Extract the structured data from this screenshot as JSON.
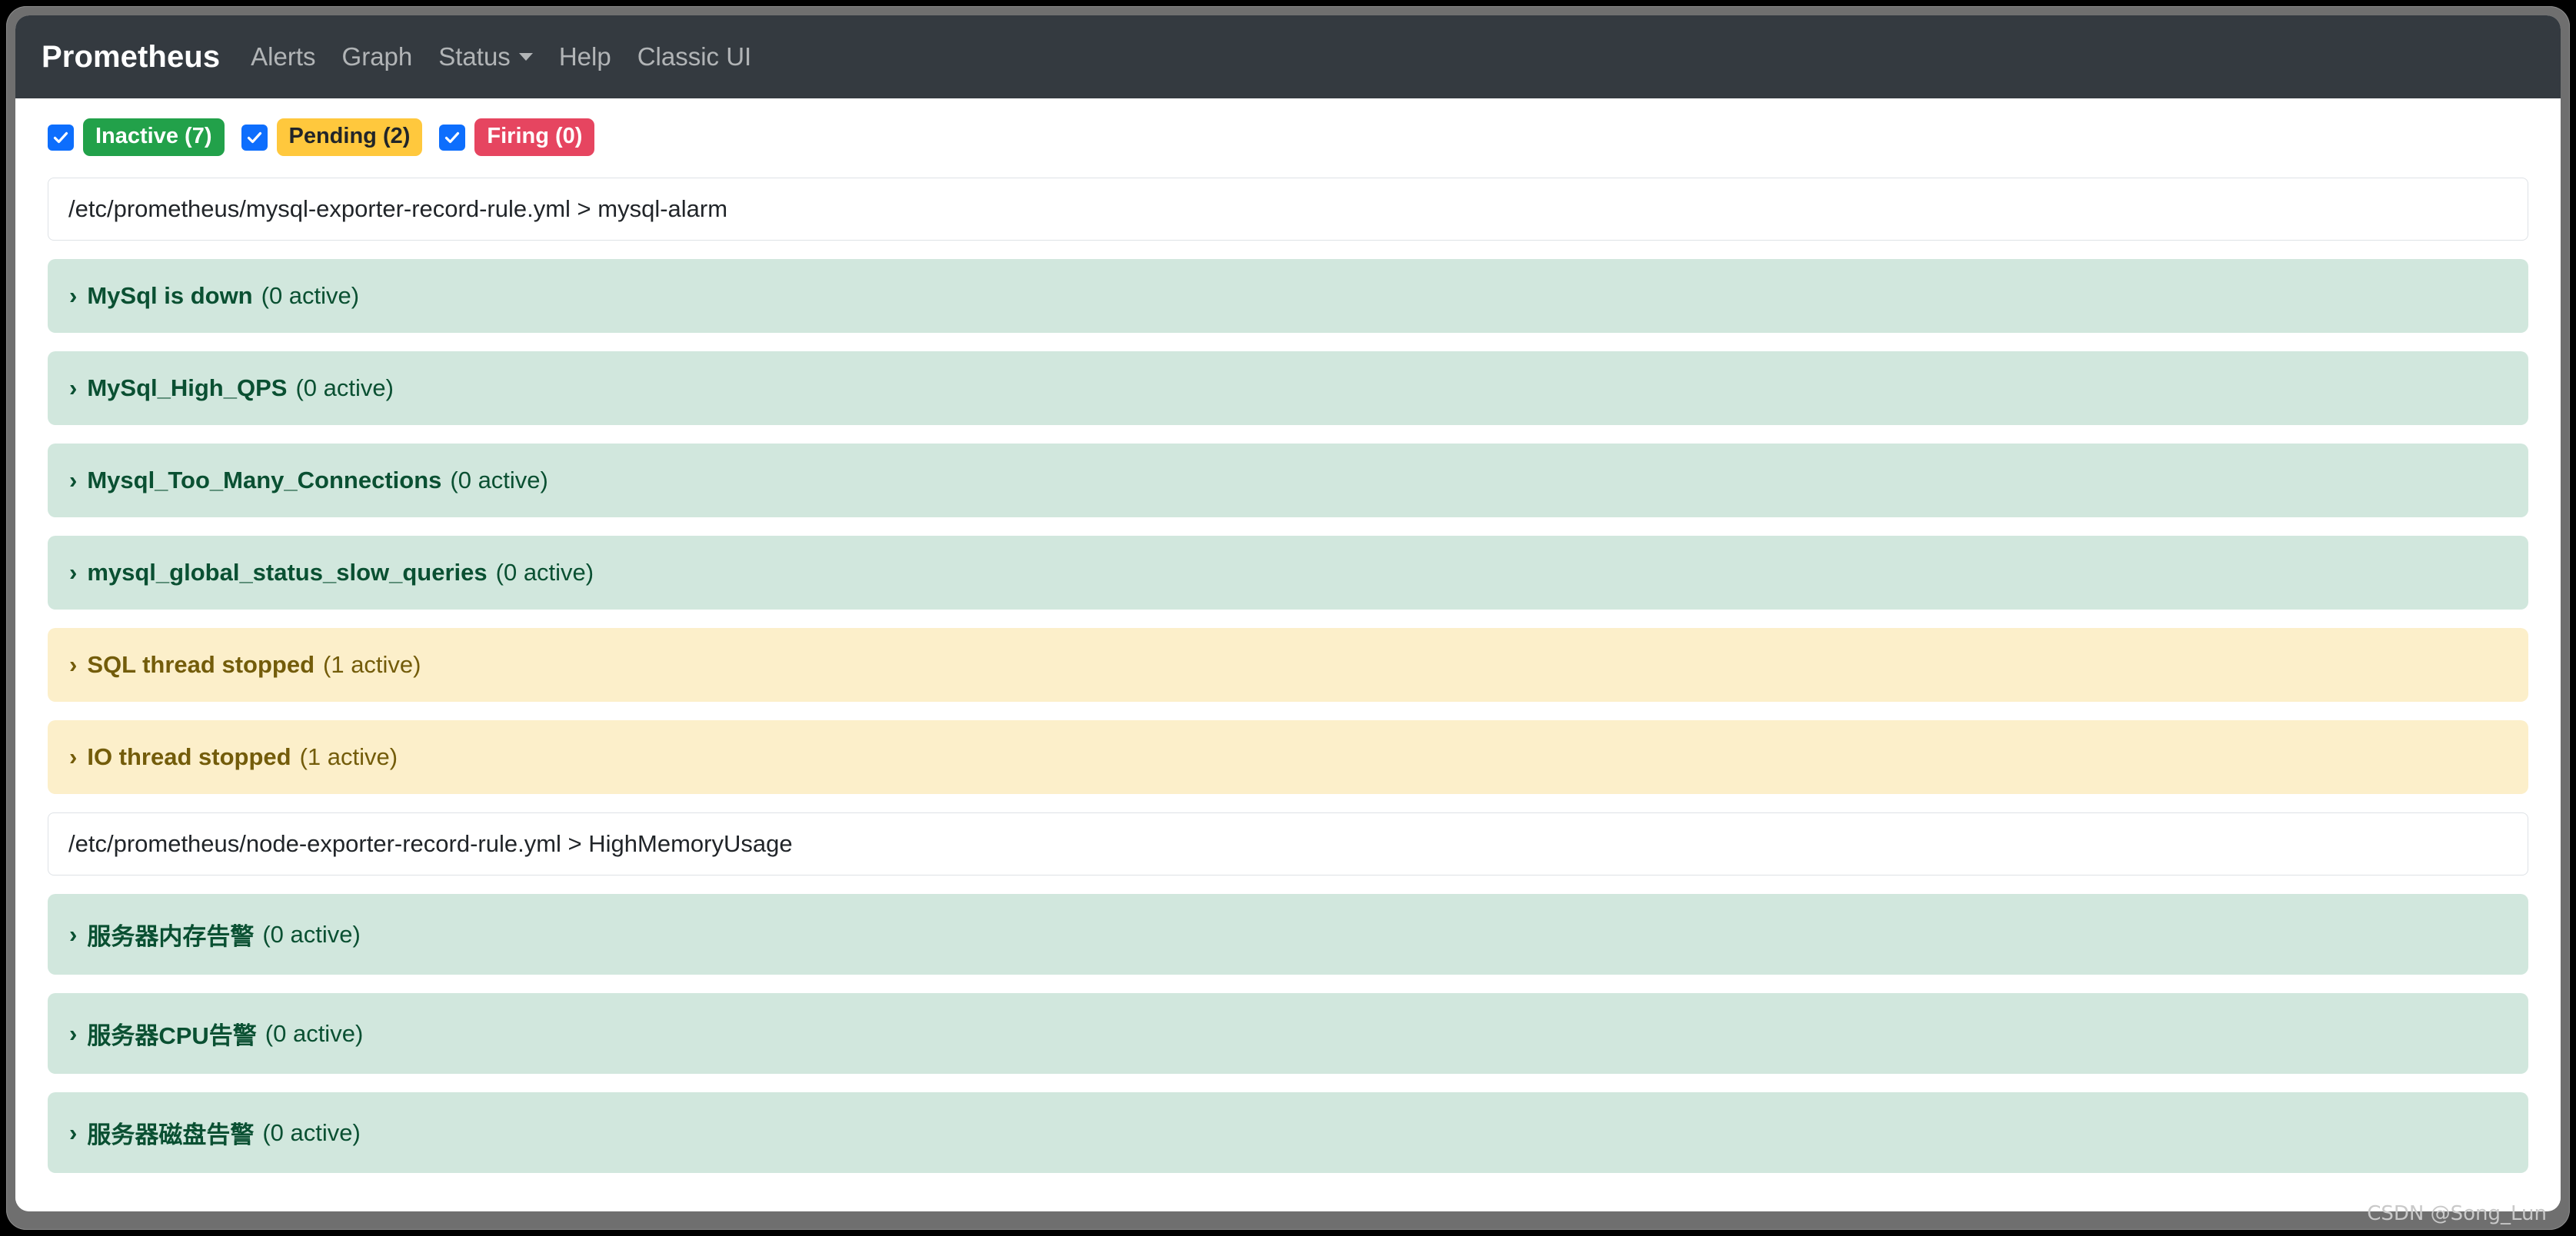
{
  "navbar": {
    "brand": "Prometheus",
    "links": [
      {
        "label": "Alerts",
        "caret": false
      },
      {
        "label": "Graph",
        "caret": false
      },
      {
        "label": "Status",
        "caret": true
      },
      {
        "label": "Help",
        "caret": false
      },
      {
        "label": "Classic UI",
        "caret": false
      }
    ]
  },
  "filters": [
    {
      "label": "Inactive (7)",
      "state": "inactive",
      "checked": true,
      "bg": "#22a14a",
      "fg": "#ffffff"
    },
    {
      "label": "Pending (2)",
      "state": "pending",
      "checked": true,
      "bg": "#ffc83d",
      "fg": "#212529"
    },
    {
      "label": "Firing (0)",
      "state": "firing",
      "checked": true,
      "bg": "#e64560",
      "fg": "#ffffff"
    }
  ],
  "groups": [
    {
      "header": "/etc/prometheus/mysql-exporter-record-rule.yml > mysql-alarm",
      "rules": [
        {
          "name": "MySql is down",
          "count": "(0 active)",
          "state": "inactive",
          "chevron": "›"
        },
        {
          "name": "MySql_High_QPS",
          "count": "(0 active)",
          "state": "inactive",
          "chevron": "›"
        },
        {
          "name": "Mysql_Too_Many_Connections",
          "count": "(0 active)",
          "state": "inactive",
          "chevron": "›"
        },
        {
          "name": "mysql_global_status_slow_queries",
          "count": "(0 active)",
          "state": "inactive",
          "chevron": "›"
        },
        {
          "name": "SQL thread stopped",
          "count": "(1 active)",
          "state": "pending",
          "chevron": "›"
        },
        {
          "name": "IO thread stopped",
          "count": "(1 active)",
          "state": "pending",
          "chevron": "›"
        }
      ]
    },
    {
      "header": "/etc/prometheus/node-exporter-record-rule.yml > HighMemoryUsage",
      "rules": [
        {
          "name": "服务器内存告警",
          "count": "(0 active)",
          "state": "inactive",
          "chevron": "›"
        },
        {
          "name": "服务器CPU告警",
          "count": "(0 active)",
          "state": "inactive",
          "chevron": "›"
        },
        {
          "name": "服务器磁盘告警",
          "count": "(0 active)",
          "state": "inactive",
          "chevron": "›"
        }
      ]
    }
  ],
  "watermark": "CSDN @Song_Lun"
}
